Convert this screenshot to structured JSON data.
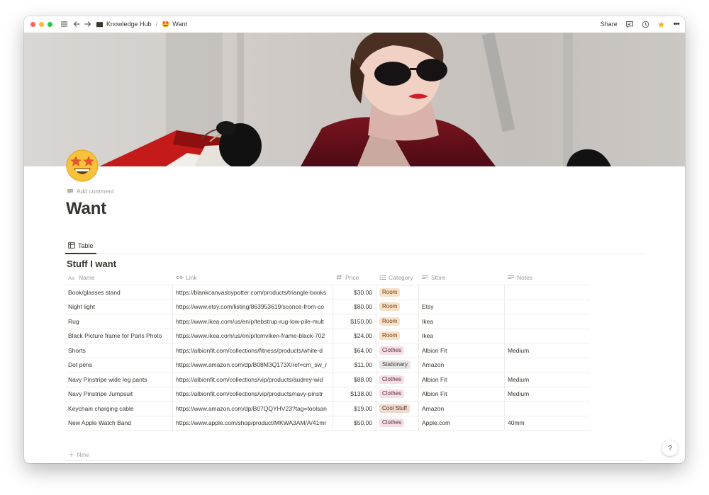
{
  "topbar": {
    "breadcrumb_workspace": "Knowledge Hub",
    "breadcrumb_separator": "/",
    "breadcrumb_page_emoji": "🤩",
    "breadcrumb_page": "Want",
    "share_label": "Share"
  },
  "page": {
    "emoji": "🤩",
    "add_comment": "Add comment",
    "title": "Want"
  },
  "view": {
    "tab_label": "Table"
  },
  "database": {
    "title": "Stuff I want",
    "columns": {
      "name": "Name",
      "link": "Link",
      "price": "Price",
      "category": "Category",
      "store": "Store",
      "notes": "Notes"
    },
    "rows": [
      {
        "name": "Book/glasses stand",
        "link": "https://blankcanvasbypotter.com/products/triangle-books",
        "price": "$30.00",
        "category": "Room",
        "store": "",
        "notes": ""
      },
      {
        "name": "Night light",
        "link": "https://www.etsy.com/listing/863953619/sconce-from-co",
        "price": "$80.00",
        "category": "Room",
        "store": "Etsy",
        "notes": ""
      },
      {
        "name": "Rug",
        "link": "https://www.ikea.com/us/en/p/tebstrup-rug-low-pile-mult",
        "price": "$150.00",
        "category": "Room",
        "store": "Ikea",
        "notes": ""
      },
      {
        "name": "Black Picture frame for Paris Photo",
        "link": "https://www.ikea.com/us/en/p/lomviken-frame-black-702",
        "price": "$24.00",
        "category": "Room",
        "store": "Ikea",
        "notes": ""
      },
      {
        "name": "Shorts",
        "link": "https://albionfit.com/collections/fitness/products/white-d",
        "price": "$64.00",
        "category": "Clothes",
        "store": "Albion Fit",
        "notes": "Medium"
      },
      {
        "name": "Dot pens",
        "link": "https://www.amazon.com/dp/B08M3Q173X/ref=cm_sw_r",
        "price": "$11.00",
        "category": "Stationary",
        "store": "Amazon",
        "notes": ""
      },
      {
        "name": "Navy Pinstripe wide leg pants",
        "link": "https://albionfit.com/collections/vip/products/audrey-wid",
        "price": "$88.00",
        "category": "Clothes",
        "store": "Albion Fit",
        "notes": "Medium"
      },
      {
        "name": "Navy Pinstripe Jumpsuit",
        "link": "https://albionfit.com/collections/vip/products/navy-pinstr",
        "price": "$138.00",
        "category": "Clothes",
        "store": "Albion Fit",
        "notes": "Medium"
      },
      {
        "name": "Keychain charging cable",
        "link": "https://www.amazon.com/dp/B07QQYHV23?tag=toolsan",
        "price": "$19.00",
        "category": "Cool Stuff",
        "store": "Amazon",
        "notes": ""
      },
      {
        "name": "New Apple Watch Band",
        "link": "https://www.apple.com/shop/product/MKWA3AM/A/41mr",
        "price": "$50.00",
        "category": "Clothes",
        "store": "Apple.com",
        "notes": "40mm"
      }
    ],
    "new_label": "New"
  },
  "help_label": "?",
  "colors": {
    "text": "#37352f",
    "muted": "#9b9a97",
    "tag_room": "#fae0c6",
    "tag_clothes": "#f5dfe6",
    "tag_stationary": "#e6e5e3",
    "tag_cool_stuff": "#eed9cf",
    "star": "#f2b01e"
  },
  "icons": [
    "menu-icon",
    "back-arrow-icon",
    "forward-arrow-icon",
    "knowledge-hub-icon",
    "comment-icon",
    "history-icon",
    "star-icon",
    "more-icon",
    "table-icon",
    "text-property-icon",
    "url-property-icon",
    "number-property-icon",
    "select-property-icon",
    "plus-icon",
    "help-icon"
  ]
}
